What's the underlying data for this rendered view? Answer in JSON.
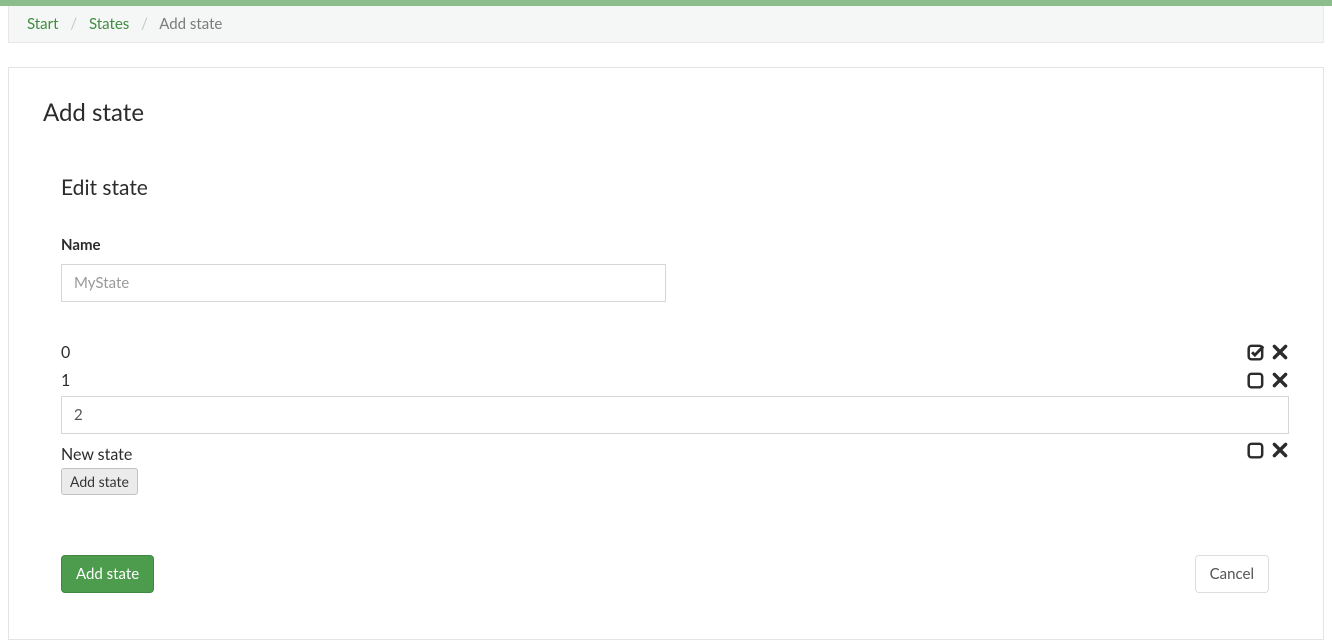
{
  "breadcrumb": {
    "start": "Start",
    "states": "States",
    "current": "Add state"
  },
  "page_title": "Add state",
  "section_title": "Edit state",
  "name_field": {
    "label": "Name",
    "placeholder": "MyState",
    "value": ""
  },
  "state_rows": {
    "row0": "0",
    "row1": "1",
    "row2_value": "2"
  },
  "new_state_label": "New state",
  "add_state_small_button": "Add state",
  "footer": {
    "submit": "Add state",
    "cancel": "Cancel"
  }
}
